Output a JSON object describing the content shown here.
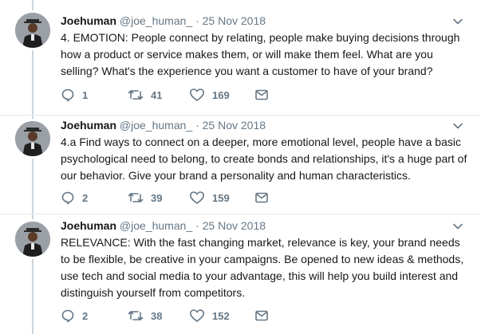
{
  "tweets": [
    {
      "name": "Joehuman",
      "handle": "@joe_human_",
      "separator": "·",
      "date": "25 Nov 2018",
      "text": "4. EMOTION: People connect by relating, people make buying decisions through how a product or service makes them, or will make them feel. What are you selling? What's the experience you want a customer to have of your brand?",
      "replies": "1",
      "retweets": "41",
      "likes": "169"
    },
    {
      "name": "Joehuman",
      "handle": "@joe_human_",
      "separator": "·",
      "date": "25 Nov 2018",
      "text": "4.a Find ways to connect on a deeper, more emotional level, people have a basic psychological need to belong, to create bonds and relationships, it's a huge part of our behavior. Give your brand a personality and human characteristics.",
      "replies": "2",
      "retweets": "39",
      "likes": "159"
    },
    {
      "name": "Joehuman",
      "handle": "@joe_human_",
      "separator": "·",
      "date": "25 Nov 2018",
      "text": "RELEVANCE: With the fast changing market, relevance is key, your brand needs to be flexible, be creative in your campaigns. Be opened to new ideas & methods, use tech and social media to your advantage, this will help you build interest and distinguish yourself from competitors.",
      "replies": "2",
      "retweets": "38",
      "likes": "152"
    }
  ],
  "icons": {
    "reply": "reply-icon",
    "retweet": "retweet-icon",
    "like": "heart-icon",
    "message": "envelope-icon",
    "caret": "chevron-down-icon"
  },
  "colors": {
    "icon_gray": "#657786",
    "thread_line": "#ccd6dd",
    "divider": "#e6ecf0"
  }
}
